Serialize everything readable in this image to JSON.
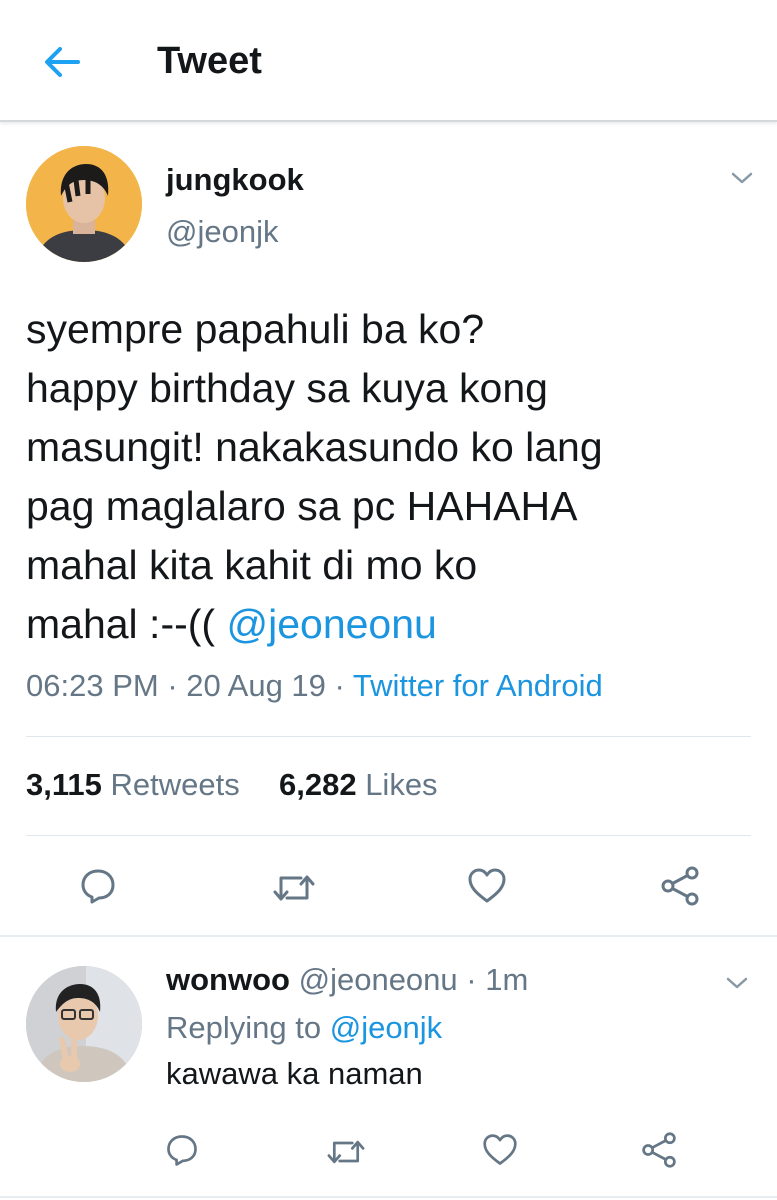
{
  "header": {
    "back_icon": "arrow-left-icon",
    "title": "Tweet"
  },
  "tweet": {
    "display_name": "jungkook",
    "handle": "@jeonjk",
    "text_lines": [
      "syempre papahuli ba ko?",
      "happy birthday sa kuya kong",
      "masungit! nakakasundo ko lang",
      "pag maglalaro sa pc HAHAHA",
      "mahal kita kahit di mo ko"
    ],
    "last_line_prefix": "mahal :--((",
    "mention": "@jeoneonu",
    "time": "06:23 PM",
    "date": "20 Aug 19",
    "source": "Twitter for Android",
    "retweets_count": "3,115",
    "retweets_label": "Retweets",
    "likes_count": "6,282",
    "likes_label": "Likes"
  },
  "reply": {
    "display_name": "wonwoo",
    "handle": "@jeoneonu",
    "time": "1m",
    "replying_to_label": "Replying to",
    "replying_to_handle": "@jeonjk",
    "text": "kawawa ka naman"
  },
  "colors": {
    "accent": "#1b95e0",
    "muted": "#657786",
    "text": "#14171a"
  },
  "icons": [
    "arrow-left-icon",
    "chevron-down-icon",
    "reply-icon",
    "retweet-icon",
    "like-icon",
    "share-icon"
  ]
}
